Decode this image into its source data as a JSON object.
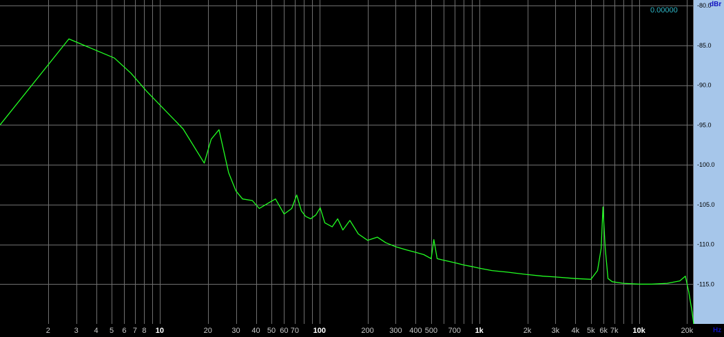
{
  "readout": "0.00000",
  "colors": {
    "background": "#000000",
    "grid": "#707070",
    "trace": "#22ff22",
    "yaxis_panel": "#a6c6ea"
  },
  "chart_data": {
    "type": "line",
    "title": "",
    "xlabel": "",
    "ylabel": "",
    "x_unit": "Hz",
    "y_unit": "dBr",
    "x_scale": "log",
    "xlim": [
      1,
      22000
    ],
    "ylim": [
      -120,
      -80
    ],
    "grid": true,
    "y_ticks": [
      {
        "value": -80,
        "label": "-80.0"
      },
      {
        "value": -85,
        "label": "-85.0"
      },
      {
        "value": -90,
        "label": "-90.0"
      },
      {
        "value": -95,
        "label": "-95.0"
      },
      {
        "value": -100,
        "label": "-100.0"
      },
      {
        "value": -105,
        "label": "-105.0"
      },
      {
        "value": -110,
        "label": "-110.0"
      },
      {
        "value": -115,
        "label": "-115.0"
      }
    ],
    "x_ticks": [
      {
        "value": 2,
        "label": "2"
      },
      {
        "value": 3,
        "label": "3"
      },
      {
        "value": 4,
        "label": "4"
      },
      {
        "value": 5,
        "label": "5"
      },
      {
        "value": 6,
        "label": "6"
      },
      {
        "value": 7,
        "label": "7"
      },
      {
        "value": 8,
        "label": "8"
      },
      {
        "value": 10,
        "label": "10",
        "bold": true
      },
      {
        "value": 20,
        "label": "20"
      },
      {
        "value": 30,
        "label": "30"
      },
      {
        "value": 40,
        "label": "40"
      },
      {
        "value": 50,
        "label": "50"
      },
      {
        "value": 60,
        "label": "60"
      },
      {
        "value": 70,
        "label": "70"
      },
      {
        "value": 100,
        "label": "100",
        "bold": true
      },
      {
        "value": 200,
        "label": "200"
      },
      {
        "value": 300,
        "label": "300"
      },
      {
        "value": 400,
        "label": "400"
      },
      {
        "value": 500,
        "label": "500"
      },
      {
        "value": 700,
        "label": "700"
      },
      {
        "value": 1000,
        "label": "1k",
        "bold": true
      },
      {
        "value": 2000,
        "label": "2k"
      },
      {
        "value": 3000,
        "label": "3k"
      },
      {
        "value": 4000,
        "label": "4k"
      },
      {
        "value": 5000,
        "label": "5k"
      },
      {
        "value": 6000,
        "label": "6k"
      },
      {
        "value": 7000,
        "label": "7k"
      },
      {
        "value": 10000,
        "label": "10k",
        "bold": true
      },
      {
        "value": 20000,
        "label": "20k"
      }
    ],
    "series": [
      {
        "points": [
          [
            1,
            -95.0
          ],
          [
            2.7,
            -84.2
          ],
          [
            5.2,
            -86.6
          ],
          [
            6.6,
            -88.5
          ],
          [
            8.3,
            -90.8
          ],
          [
            14,
            -95.5
          ],
          [
            19,
            -99.8
          ],
          [
            21,
            -96.8
          ],
          [
            23.5,
            -95.6
          ],
          [
            27,
            -101.0
          ],
          [
            30,
            -103.3
          ],
          [
            33,
            -104.3
          ],
          [
            38,
            -104.5
          ],
          [
            42,
            -105.5
          ],
          [
            48,
            -104.8
          ],
          [
            53,
            -104.3
          ],
          [
            60,
            -106.2
          ],
          [
            67,
            -105.5
          ],
          [
            72,
            -103.8
          ],
          [
            77,
            -105.8
          ],
          [
            82,
            -106.5
          ],
          [
            88,
            -106.8
          ],
          [
            95,
            -106.3
          ],
          [
            101,
            -105.4
          ],
          [
            108,
            -107.3
          ],
          [
            120,
            -107.8
          ],
          [
            130,
            -106.8
          ],
          [
            140,
            -108.2
          ],
          [
            155,
            -107.0
          ],
          [
            175,
            -108.7
          ],
          [
            200,
            -109.5
          ],
          [
            230,
            -109.1
          ],
          [
            260,
            -109.8
          ],
          [
            300,
            -110.3
          ],
          [
            350,
            -110.7
          ],
          [
            400,
            -111.0
          ],
          [
            450,
            -111.3
          ],
          [
            500,
            -111.8
          ],
          [
            520,
            -109.4
          ],
          [
            545,
            -111.8
          ],
          [
            600,
            -112.0
          ],
          [
            700,
            -112.3
          ],
          [
            800,
            -112.6
          ],
          [
            900,
            -112.8
          ],
          [
            1000,
            -113.0
          ],
          [
            1200,
            -113.3
          ],
          [
            1500,
            -113.5
          ],
          [
            2000,
            -113.8
          ],
          [
            2500,
            -114.0
          ],
          [
            3000,
            -114.1
          ],
          [
            4000,
            -114.3
          ],
          [
            5000,
            -114.4
          ],
          [
            5500,
            -113.3
          ],
          [
            5800,
            -110.5
          ],
          [
            5950,
            -105.3
          ],
          [
            6150,
            -110.5
          ],
          [
            6400,
            -114.3
          ],
          [
            6800,
            -114.7
          ],
          [
            8000,
            -114.9
          ],
          [
            10000,
            -115.0
          ],
          [
            12000,
            -115.0
          ],
          [
            15000,
            -114.9
          ],
          [
            18000,
            -114.6
          ],
          [
            19500,
            -114.0
          ],
          [
            20500,
            -116.0
          ],
          [
            21500,
            -118.5
          ],
          [
            22000,
            -120.0
          ]
        ]
      }
    ]
  }
}
